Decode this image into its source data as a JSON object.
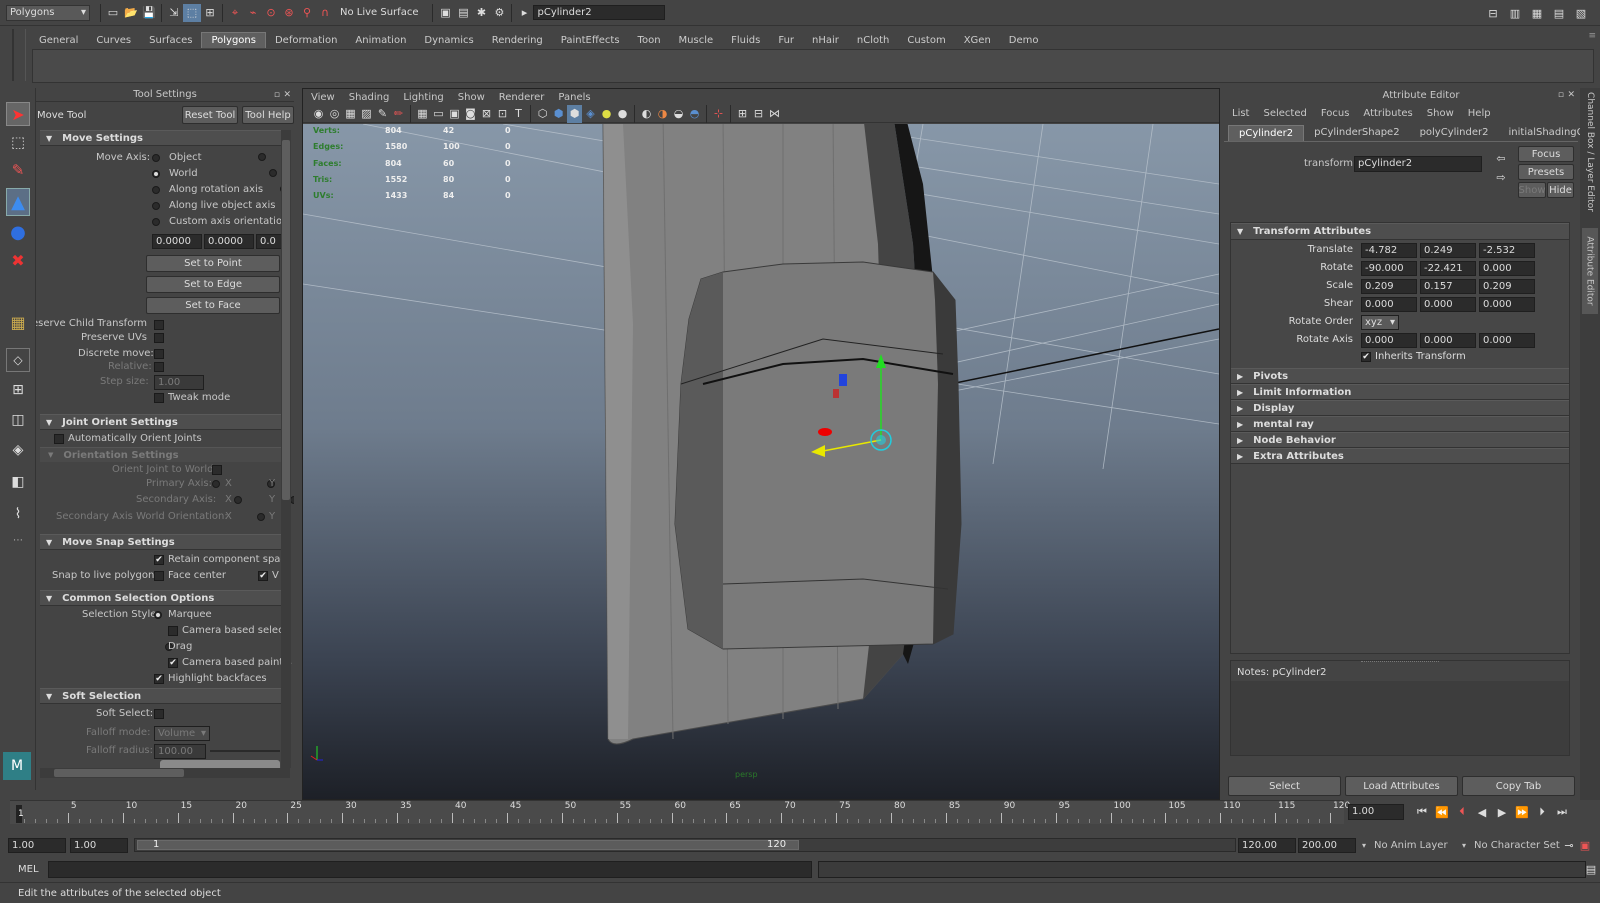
{
  "status_line": {
    "menu_set": "Polygons",
    "live_surface": "No Live Surface",
    "name_field": "pCylinder2"
  },
  "shelf_tabs": [
    "General",
    "Curves",
    "Surfaces",
    "Polygons",
    "Deformation",
    "Animation",
    "Dynamics",
    "Rendering",
    "PaintEffects",
    "Toon",
    "Muscle",
    "Fluids",
    "Fur",
    "nHair",
    "nCloth",
    "Custom",
    "XGen",
    "Demo"
  ],
  "tool_settings": {
    "panel_title": "Tool Settings",
    "tool_name": "Move Tool",
    "reset_label": "Reset Tool",
    "help_label": "Tool Help",
    "move_settings": {
      "title": "Move Settings",
      "axis_label": "Move Axis:",
      "axes": [
        "Object",
        "World",
        "Along rotation axis",
        "Along live object axis",
        "Custom axis orientation"
      ],
      "selected_axis": "World",
      "values": [
        "0.0000",
        "0.0000",
        "0.0"
      ],
      "set_to_point": "Set to Point",
      "set_to_edge": "Set to Edge",
      "set_to_face": "Set to Face",
      "preserve_child": "Preserve Child Transform",
      "preserve_uvs": "Preserve UVs",
      "discrete_move": "Discrete move:",
      "relative": "Relative:",
      "step_size": "Step size:",
      "step_value": "1.00",
      "tweak_mode": "Tweak mode"
    },
    "joint_orient": {
      "title": "Joint Orient Settings",
      "auto_orient": "Automatically Orient Joints",
      "orientation_settings": "Orientation Settings",
      "orient_world": "Orient Joint to World:",
      "primary_axis": "Primary Axis:",
      "secondary_axis": "Secondary Axis:",
      "secondary_world": "Secondary Axis World Orientation:",
      "x": "X",
      "y": "Y"
    },
    "move_snap": {
      "title": "Move Snap Settings",
      "retain": "Retain component spaci",
      "snap_live": "Snap to live polygon:",
      "face_center": "Face center",
      "v": "V"
    },
    "common_selection": {
      "title": "Common Selection Options",
      "style_label": "Selection Style:",
      "marquee": "Marquee",
      "camera_select": "Camera based select",
      "drag": "Drag",
      "camera_paint": "Camera based paint s",
      "highlight": "Highlight backfaces"
    },
    "soft_selection": {
      "title": "Soft Selection",
      "soft_select": "Soft Select:",
      "falloff_mode": "Falloff mode:",
      "falloff_value": "Volume",
      "falloff_radius": "Falloff radius:",
      "radius_value": "100.00"
    }
  },
  "viewport": {
    "menus": [
      "View",
      "Shading",
      "Lighting",
      "Show",
      "Renderer",
      "Panels"
    ],
    "stats": [
      {
        "label": "Verts:",
        "a": "804",
        "b": "42",
        "c": "0"
      },
      {
        "label": "Edges:",
        "a": "1580",
        "b": "100",
        "c": "0"
      },
      {
        "label": "Faces:",
        "a": "804",
        "b": "60",
        "c": "0"
      },
      {
        "label": "Tris:",
        "a": "1552",
        "b": "80",
        "c": "0"
      },
      {
        "label": "UVs:",
        "a": "1433",
        "b": "84",
        "c": "0"
      }
    ],
    "camera": "persp"
  },
  "attribute_editor": {
    "title": "Attribute Editor",
    "menus": [
      "List",
      "Selected",
      "Focus",
      "Attributes",
      "Show",
      "Help"
    ],
    "tabs": [
      "pCylinder2",
      "pCylinderShape2",
      "polyCylinder2",
      "initialShadingG"
    ],
    "focus": "Focus",
    "presets": "Presets",
    "show": "Show",
    "hide": "Hide",
    "transform_label": "transform:",
    "transform_value": "pCylinder2",
    "section": "Transform Attributes",
    "rows": [
      {
        "label": "Translate",
        "v": [
          "-4.782",
          "0.249",
          "-2.532"
        ]
      },
      {
        "label": "Rotate",
        "v": [
          "-90.000",
          "-22.421",
          "0.000"
        ]
      },
      {
        "label": "Scale",
        "v": [
          "0.209",
          "0.157",
          "0.209"
        ]
      },
      {
        "label": "Shear",
        "v": [
          "0.000",
          "0.000",
          "0.000"
        ]
      }
    ],
    "rotate_order_label": "Rotate Order",
    "rotate_order": "xyz",
    "rotate_axis": {
      "label": "Rotate Axis",
      "v": [
        "0.000",
        "0.000",
        "0.000"
      ]
    },
    "inherits": "Inherits Transform",
    "collapsed": [
      "Pivots",
      "Limit Information",
      "Display",
      "mental ray",
      "Node Behavior",
      "Extra Attributes"
    ],
    "notes": "Notes:  pCylinder2",
    "select": "Select",
    "load": "Load Attributes",
    "copy": "Copy Tab"
  },
  "side_tabs": {
    "channel_box": "Channel Box / Layer Editor",
    "attr_editor": "Attribute Editor"
  },
  "timeline": {
    "ticks": [
      "5",
      "10",
      "15",
      "20",
      "25",
      "30",
      "35",
      "40",
      "45",
      "50",
      "55",
      "60",
      "65",
      "70",
      "75",
      "80",
      "85",
      "90",
      "95",
      "100",
      "105",
      "110",
      "115",
      "120"
    ],
    "current": "1",
    "current_field": "1.00"
  },
  "range": {
    "start": "1.00",
    "start2": "1.00",
    "slider_start": "1",
    "slider_end": "120",
    "end": "120.00",
    "end2": "200.00",
    "anim_layer": "No Anim Layer",
    "char_set": "No Character Set"
  },
  "command": {
    "label": "MEL"
  },
  "help_line": "Edit the attributes of the selected object"
}
